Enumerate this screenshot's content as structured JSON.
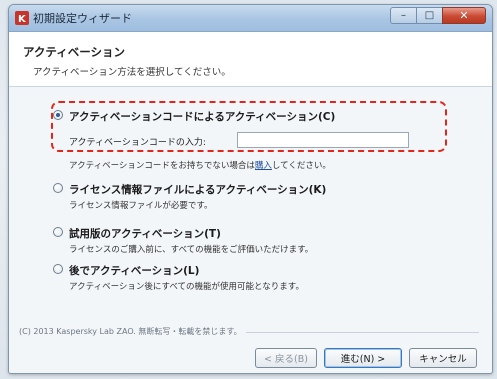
{
  "window": {
    "title": "初期設定ウィザード",
    "controls": {
      "minimize": "–",
      "maximize": "□",
      "close": "✕"
    }
  },
  "header": {
    "heading": "アクティベーション",
    "subheading": "アクティベーション方法を選択してください。"
  },
  "options": [
    {
      "label": "アクティベーションコードによるアクティベーション(C)",
      "selected": true,
      "code_label": "アクティベーションコードの入力:",
      "code_value": "",
      "note_before": "アクティベーションコードをお持ちでない場合は",
      "note_link": "購入",
      "note_after": "してください。"
    },
    {
      "label": "ライセンス情報ファイルによるアクティベーション(K)",
      "description": "ライセンス情報ファイルが必要です。",
      "selected": false
    },
    {
      "label": "試用版のアクティベーション(T)",
      "description": "ライセンスのご購入前に、すべての機能をご評価いただけます。",
      "selected": false
    },
    {
      "label": "後でアクティベーション(L)",
      "description": "アクティベーション後にすべての機能が使用可能となります。",
      "selected": false
    }
  ],
  "footer": {
    "copyright": "(C) 2013 Kaspersky Lab ZAO. 無断転写・転載を禁じます。",
    "back_label": "< 戻る(B)",
    "next_label": "進む(N) >",
    "cancel_label": "キャンセル"
  },
  "colors": {
    "highlight": "#e3261d",
    "link": "#1f4fa3"
  },
  "icons": {
    "app": "kaspersky-k-icon"
  }
}
